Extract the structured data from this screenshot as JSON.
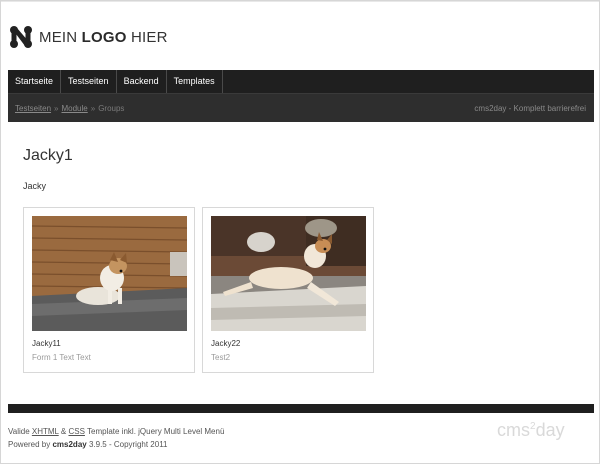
{
  "logo": {
    "part1": "MEIN ",
    "part2": "LOGO",
    "part3": " HIER"
  },
  "nav": [
    {
      "label": "Startseite"
    },
    {
      "label": "Testseiten"
    },
    {
      "label": "Backend"
    },
    {
      "label": "Templates"
    }
  ],
  "breadcrumb": {
    "items": [
      "Testseiten",
      "Module",
      "Groups"
    ],
    "separator": "»",
    "tagline": "cms2day - Komplett barrierefrei"
  },
  "page": {
    "title": "Jacky1",
    "subtitle": "Jacky"
  },
  "gallery": [
    {
      "name": "Jacky11",
      "description": "Form 1 Text Text"
    },
    {
      "name": "Jacky22",
      "description": "Test2"
    }
  ],
  "footer": {
    "valid_prefix": "Valide ",
    "xhtml": "XHTML",
    "and": " & ",
    "css": "CSS",
    "valid_suffix": " Template inkl. jQuery Multi Level Menü",
    "powered_prefix": "Powered by ",
    "powered_brand": "cms2day",
    "powered_suffix": " 3.9.5 - Copyright 2011",
    "watermark_a": "cms",
    "watermark_sup": "2",
    "watermark_b": "day"
  },
  "colors": {
    "nav_bg": "#1f1f1f",
    "crumb_bg": "#2e2e2e",
    "text": "#333333",
    "muted": "#9a9a9a"
  }
}
